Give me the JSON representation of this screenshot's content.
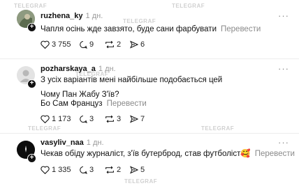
{
  "watermark": "TELEGRAF",
  "more_label": "···",
  "comments": [
    {
      "username": "ruzhena_ky",
      "time": "1 дн.",
      "lines": [
        "Чапля осінь жде завзято, буде сани фарбувати"
      ],
      "translate": "Перевести",
      "likes": "3 755",
      "replies": "9",
      "reposts": "2",
      "shares": "6"
    },
    {
      "username": "pozharskaya_a",
      "time": "1 дн.",
      "lines": [
        "З усіх варіантів мені найбільше подобається цей",
        "Чому Пан Жабу З'їв?",
        "Бо Сам Француз"
      ],
      "translate": "Перевести",
      "likes": "1 173",
      "replies": "3",
      "reposts": "3",
      "shares": "7"
    },
    {
      "username": "vasyliv_naa",
      "time": "1 дн.",
      "lines": [
        "Чекав обіду журналіст, з'їв бутерброд, став футболіст🥰"
      ],
      "translate": "Перевести",
      "likes": "1 335",
      "replies": "3",
      "reposts": "2",
      "shares": "5"
    }
  ]
}
